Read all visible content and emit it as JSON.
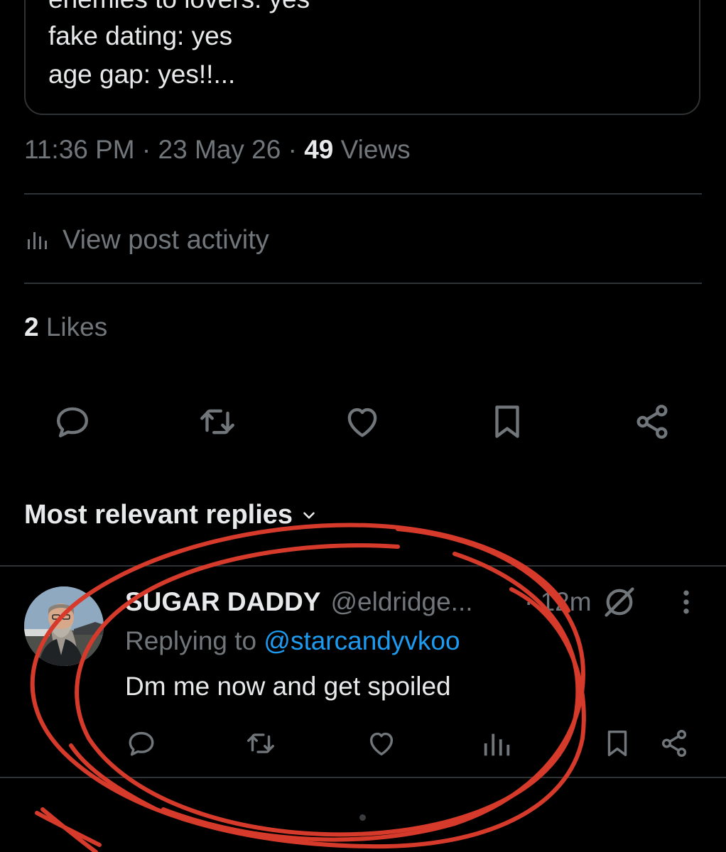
{
  "post": {
    "card_lines": [
      "enemies to lovers: yes",
      "fake dating: yes",
      "age gap: yes!!..."
    ],
    "time": "11:36 PM",
    "date": "23 May 26",
    "views_count": "49",
    "views_label": "Views",
    "activity_label": "View post activity",
    "likes_count": "2",
    "likes_label": "Likes"
  },
  "actions": {
    "icons": [
      "reply-icon",
      "repost-icon",
      "like-icon",
      "bookmark-icon",
      "share-icon"
    ]
  },
  "replies": {
    "header": "Most relevant replies",
    "items": [
      {
        "name": "SUGAR DADDY",
        "handle": "@eldridge...",
        "time": "12m",
        "replying_prefix": "Replying to",
        "replying_to": "@starcandyvkoo",
        "text": "Dm me now and get spoiled"
      }
    ]
  },
  "colors": {
    "background": "#000000",
    "text": "#e7e9ea",
    "muted": "#71767b",
    "divider": "#2f3336",
    "link": "#1d9bf0",
    "annotation": "#d63a2a"
  }
}
